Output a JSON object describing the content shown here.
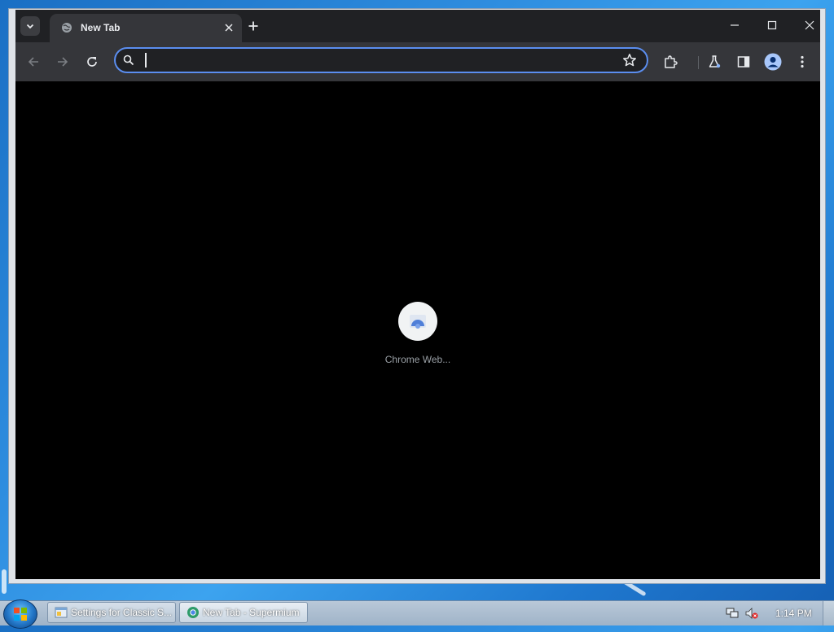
{
  "browser": {
    "tab": {
      "title": "New Tab"
    },
    "omnibox": {
      "value": "",
      "placeholder": ""
    },
    "icons": {
      "tab_search": "chevron-down-icon",
      "favicon": "globe-icon",
      "tab_close": "close-icon",
      "new_tab": "plus-icon",
      "minimize": "minimize-icon",
      "maximize": "maximize-icon",
      "close": "close-icon",
      "back": "arrow-left-icon",
      "forward": "arrow-right-icon",
      "reload": "reload-icon",
      "search": "search-icon",
      "bookmark": "star-icon",
      "extensions": "puzzle-icon",
      "labs": "flask-icon",
      "side_panel": "side-panel-icon",
      "profile": "person-icon",
      "menu": "dots-vertical-icon"
    },
    "shortcut": {
      "label": "Chrome Web...",
      "icon": "web-store-icon"
    }
  },
  "taskbar": {
    "buttons": [
      {
        "label": "Settings for Classic S...",
        "icon": "settings-window-icon"
      },
      {
        "label": "New Tab - Supermium",
        "icon": "browser-icon"
      }
    ],
    "clock": "1:14 PM",
    "tray_icons": [
      "network-icon",
      "volume-muted-icon"
    ]
  },
  "colors": {
    "frame": "#202124",
    "toolbar": "#35363a",
    "omnibox_focus": "#5b8ef0",
    "content": "#000000"
  }
}
